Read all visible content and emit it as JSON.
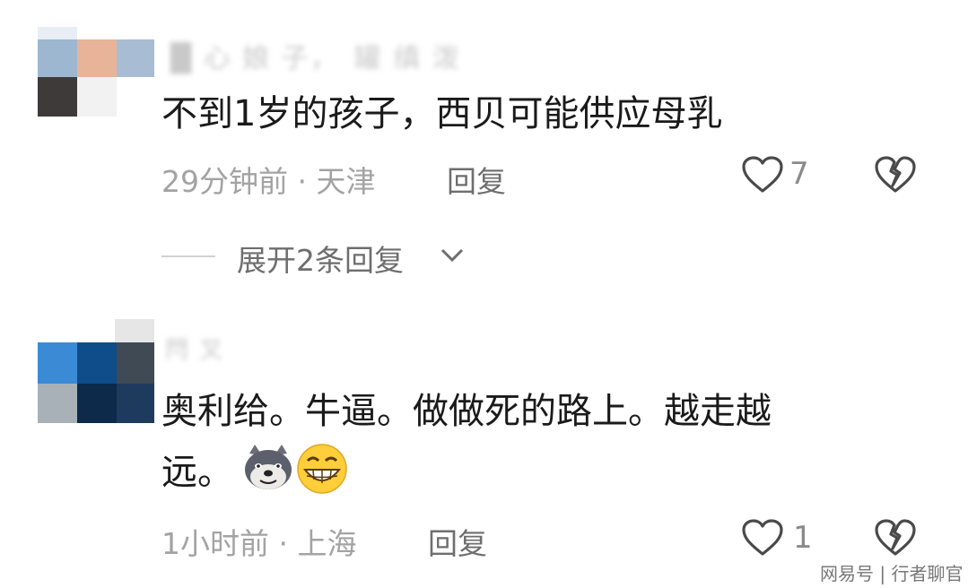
{
  "comments": [
    {
      "username": "█ 心 娘 子，　罐 缜 泼",
      "text": "不到1岁的孩子，西贝可能供应母乳",
      "time_location": "29分钟前 · 天津",
      "reply_label": "回复",
      "likes": "7",
      "expand_label": "展开2条回复"
    },
    {
      "username": "閂 叉",
      "text_line1": "奥利给。牛逼。做做死的路上。越走越",
      "text_line2": "远。",
      "emojis": [
        "doge-icon",
        "grin-icon"
      ],
      "time_location": "1小时前 · 上海",
      "reply_label": "回复",
      "likes": "1"
    }
  ],
  "watermark": "网易号 | 行者聊官"
}
